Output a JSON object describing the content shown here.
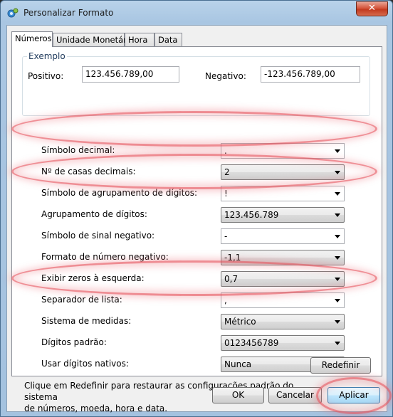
{
  "window": {
    "title": "Personalizar Formato"
  },
  "tabs": [
    "Números",
    "Unidade Monetária",
    "Hora",
    "Data"
  ],
  "example": {
    "legend": "Exemplo",
    "positive_label": "Positivo:",
    "positive_value": "123.456.789,00",
    "negative_label": "Negativo:",
    "negative_value": "-123.456.789,00"
  },
  "rows": [
    {
      "label": "Símbolo decimal:",
      "value": "."
    },
    {
      "label": "Nº de casas decimais:",
      "value": "2"
    },
    {
      "label": "Símbolo de agrupamento de dígitos:",
      "value": "!"
    },
    {
      "label": "Agrupamento de dígitos:",
      "value": "123.456.789"
    },
    {
      "label": "Símbolo de sinal negativo:",
      "value": "-"
    },
    {
      "label": "Formato de número negativo:",
      "value": "-1,1"
    },
    {
      "label": "Exibir zeros à esquerda:",
      "value": "0,7"
    },
    {
      "label": "Separador de lista:",
      "value": ","
    },
    {
      "label": "Sistema de medidas:",
      "value": "Métrico"
    },
    {
      "label": "Dígitos padrão:",
      "value": "0123456789"
    },
    {
      "label": "Usar dígitos nativos:",
      "value": "Nunca"
    }
  ],
  "note": {
    "line1": "Clique em Redefinir para restaurar as configurações padrão do sistema",
    "line2": "de números, moeda, hora e data."
  },
  "buttons": {
    "reset": "Redefinir",
    "ok": "OK",
    "cancel": "Cancelar",
    "apply": "Aplicar"
  },
  "colors": {
    "highlight": "#e8505a",
    "title_bar": "#a9c6e2",
    "close_button": "#c23a1f"
  }
}
